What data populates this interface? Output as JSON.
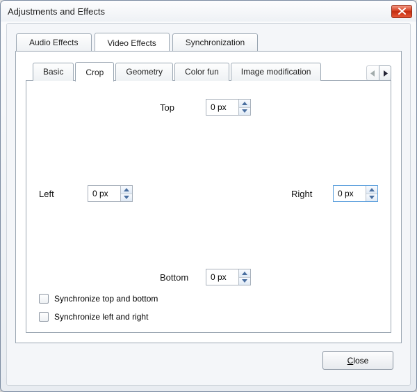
{
  "window": {
    "title": "Adjustments and Effects"
  },
  "primary_tabs": {
    "audio": "Audio Effects",
    "video": "Video Effects",
    "sync": "Synchronization"
  },
  "sub_tabs": {
    "basic": "Basic",
    "crop": "Crop",
    "geometry": "Geometry",
    "colorfun": "Color fun",
    "imgmod": "Image modification"
  },
  "crop": {
    "top": {
      "label": "Top",
      "value": "0 px"
    },
    "left": {
      "label": "Left",
      "value": "0 px"
    },
    "right": {
      "label": "Right",
      "value": "0 px"
    },
    "bottom": {
      "label": "Bottom",
      "value": "0 px"
    },
    "sync_tb": "Synchronize top and bottom",
    "sync_lr": "Synchronize left and right"
  },
  "footer": {
    "close_underline": "C",
    "close_rest": "lose"
  }
}
